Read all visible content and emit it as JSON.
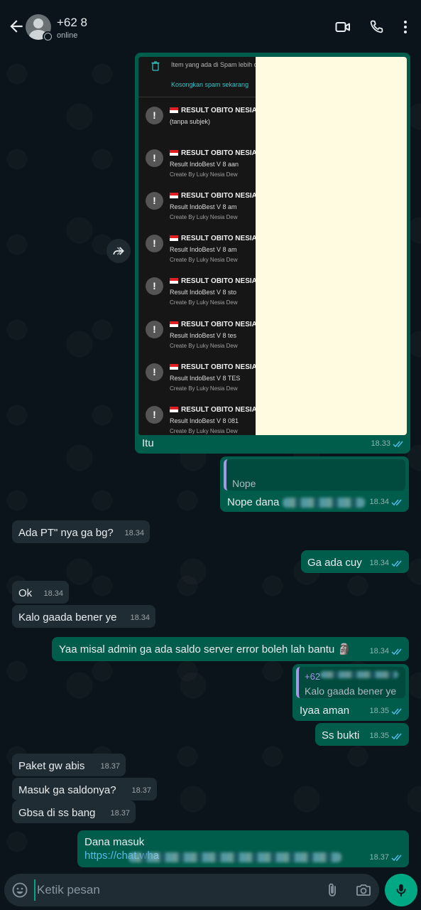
{
  "header": {
    "contact_name": "+62 8",
    "status": "online"
  },
  "screenshot": {
    "spam_info": "Item yang ada di Spam lebih d",
    "spam_action": "Kosongkan spam sekarang",
    "rows": [
      {
        "title": "RESULT OBITO NESIA",
        "line2": "(tanpa subjek)",
        "line3": ""
      },
      {
        "title": "RESULT OBITO NESIA",
        "line2": "Result IndoBest V 8 aan",
        "line3": "Create By Luky Nesia Dew"
      },
      {
        "title": "RESULT OBITO NESIA",
        "line2": "Result IndoBest V 8 am",
        "line3": "Create By Luky Nesia Dew"
      },
      {
        "title": "RESULT OBITO NESIA",
        "line2": "Result IndoBest V 8 am",
        "line3": "Create By Luky Nesia Dew"
      },
      {
        "title": "RESULT OBITO NESIA",
        "line2": "Result IndoBest V 8 sto",
        "line3": "Create By Luky Nesia Dew"
      },
      {
        "title": "RESULT OBITO NESIA",
        "line2": "Result IndoBest V 8 tes",
        "line3": "Create By Luky Nesia Dew"
      },
      {
        "title": "RESULT OBITO NESIA",
        "line2": "Result IndoBest V 8 TES",
        "line3": "Create By Luky Nesia Dew"
      },
      {
        "title": "RESULT OBITO NESIA",
        "line2": "Result IndoBest V 8 081",
        "line3": "Create By Luky Nesia Dew"
      }
    ]
  },
  "messages": {
    "m1": {
      "text": "Itu",
      "time": "18.33"
    },
    "m2": {
      "quote_text": "Nope",
      "text": "Nope dana",
      "time": "18.34"
    },
    "m3": {
      "text": "Ada PT\" nya ga bg?",
      "time": "18.34"
    },
    "m4": {
      "text": "Ga ada cuy",
      "time": "18.34"
    },
    "m5": {
      "text": "Ok",
      "time": "18.34"
    },
    "m6": {
      "text": "Kalo gaada bener ye",
      "time": "18.34"
    },
    "m7": {
      "text": "Yaa misal admin ga ada saldo server error boleh lah bantu 🗿",
      "time": "18.34"
    },
    "m8": {
      "quote_name": "+62",
      "quote_text": "Kalo gaada bener ye",
      "text": "Iyaa aman",
      "time": "18.35"
    },
    "m9": {
      "text": "Ss bukti",
      "time": "18.35"
    },
    "m10": {
      "text": "Paket gw abis",
      "time": "18.37"
    },
    "m11": {
      "text": "Masuk ga saldonya?",
      "time": "18.37"
    },
    "m12": {
      "text": "Gbsa di ss bang",
      "time": "18.37"
    },
    "m13": {
      "text": "Dana masuk",
      "link": "https://chat.wha",
      "time": "18.37"
    }
  },
  "input": {
    "placeholder": "Ketik pesan"
  },
  "colors": {
    "background": "#0b141a",
    "incoming": "#202c33",
    "outgoing": "#005c4b",
    "accent": "#00a884",
    "read_ticks": "#53bdeb"
  },
  "icons": [
    "back-arrow-icon",
    "video-call-icon",
    "phone-icon",
    "more-vert-icon",
    "forward-icon",
    "emoji-icon",
    "attach-icon",
    "camera-icon",
    "mic-icon"
  ]
}
